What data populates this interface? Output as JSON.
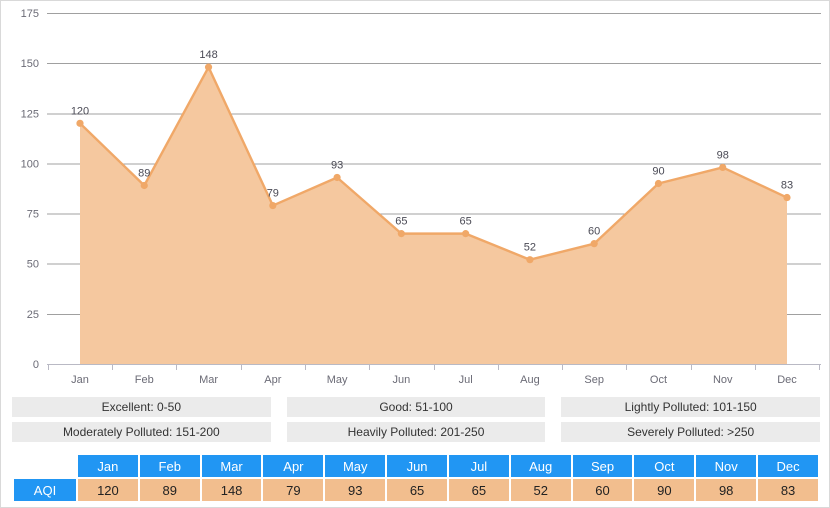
{
  "chart_data": {
    "type": "area",
    "title": "",
    "xlabel": "",
    "ylabel": "",
    "categories": [
      "Jan",
      "Feb",
      "Mar",
      "Apr",
      "May",
      "Jun",
      "Jul",
      "Aug",
      "Sep",
      "Oct",
      "Nov",
      "Dec"
    ],
    "series": [
      {
        "name": "AQI",
        "values": [
          120,
          89,
          148,
          79,
          93,
          65,
          65,
          52,
          60,
          90,
          98,
          83
        ]
      }
    ],
    "ylim": [
      0,
      175
    ],
    "yticks": [
      0,
      25,
      50,
      75,
      100,
      125,
      150,
      175
    ],
    "ytick_labels": [
      "0",
      "25",
      "50",
      "75",
      "100",
      "125",
      "150",
      "175"
    ],
    "grid": true,
    "legend_position": "none",
    "data_labels": [
      "120",
      "89",
      "148",
      "79",
      "93",
      "65",
      "65",
      "52",
      "60",
      "90",
      "98",
      "83"
    ],
    "colors": {
      "area_fill": "#f5c89f",
      "line": "#f0a868",
      "marker": "#f0a868",
      "grid": "#a0a0a0",
      "axis": "#b9b9c4",
      "tick_text": "#6b6b76",
      "label_text": "#4a4a55"
    }
  },
  "legend": {
    "colors": {
      "background": "#ebebeb",
      "text": "#333333"
    },
    "rows": [
      [
        "Excellent: 0-50",
        "Good: 51-100",
        "Lightly Polluted: 101-150"
      ],
      [
        "Moderately Polluted: 151-200",
        "Heavily Polluted: 201-250",
        "Severely Polluted: >250"
      ]
    ]
  },
  "table": {
    "colors": {
      "header": "#2196f3",
      "header_text": "#ffffff",
      "cell": "#f2be8e",
      "cell_text": "#222222"
    },
    "corner_label": "",
    "columns": [
      "Jan",
      "Feb",
      "Mar",
      "Apr",
      "May",
      "Jun",
      "Jul",
      "Aug",
      "Sep",
      "Oct",
      "Nov",
      "Dec"
    ],
    "row_label": "AQI",
    "row_values": [
      "120",
      "89",
      "148",
      "79",
      "93",
      "65",
      "65",
      "52",
      "60",
      "90",
      "98",
      "83"
    ]
  }
}
